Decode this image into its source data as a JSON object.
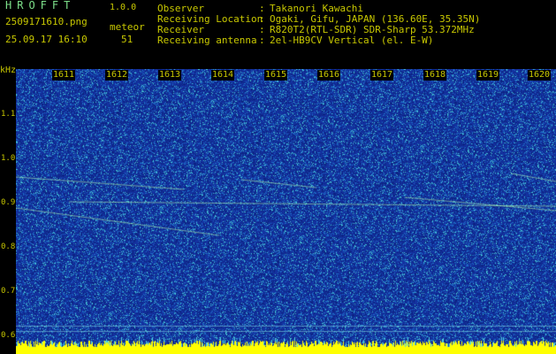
{
  "header": {
    "app_name": "HROFFT",
    "version": "1.0.0",
    "file_name": "2509171610.png",
    "detection_label": "meteor",
    "datetime": "25.09.17 16:10",
    "meteor_count": "51",
    "info": [
      {
        "label": "Observer",
        "value": "Takanori Kawachi"
      },
      {
        "label": "Receiving Location",
        "value": "Ogaki, Gifu, JAPAN (136.60E, 35.35N)"
      },
      {
        "label": "Receiver",
        "value": "R820T2(RTL-SDR) SDR-Sharp 53.372MHz"
      },
      {
        "label": "Receiving antenna",
        "value": "2el-HB9CV Vertical (el. E-W)"
      }
    ]
  },
  "spectrogram": {
    "unit_label": "kHz",
    "y_ticks": [
      "1.1",
      "1.0",
      "0.9",
      "0.8",
      "0.7",
      "0.6"
    ],
    "x_ticks": [
      "1611",
      "1612",
      "1613",
      "1614",
      "1615",
      "1616",
      "1617",
      "1618",
      "1619",
      "1620"
    ],
    "colors": {
      "background": "#1e3fb0",
      "noise": "#4fd3e0",
      "signal": "#b8ffb0",
      "baseline": "#ffff00",
      "text": "#c8c800"
    }
  }
}
